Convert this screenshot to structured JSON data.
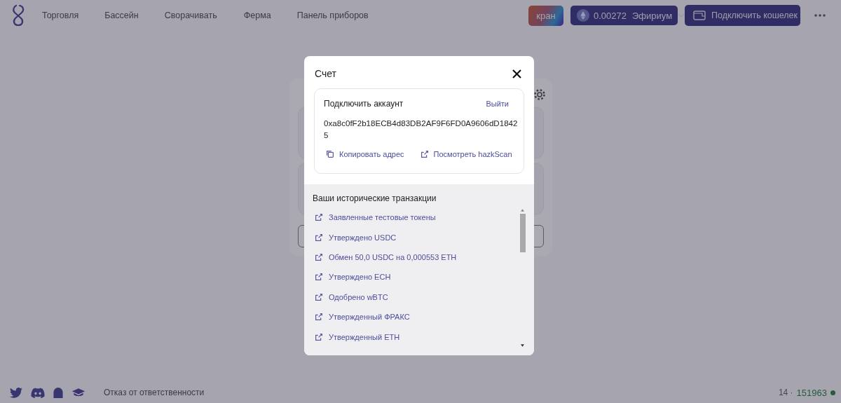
{
  "header": {
    "nav": [
      {
        "label": "Торговля"
      },
      {
        "label": "Бассейн"
      },
      {
        "label": "Сворачивать"
      },
      {
        "label": "Ферма"
      },
      {
        "label": "Панель приборов"
      }
    ],
    "faucet_button": "кран",
    "network_button": {
      "balance": "0.00272",
      "currency": "Эфириум"
    },
    "connect_button": "Подключить кошелек"
  },
  "modal": {
    "title": "Счет",
    "account": {
      "heading": "Подключить аккаунт",
      "logout": "Выйти",
      "address": "0xa8c0fF2b18ECB4d83DB2AF9F6FD0A9606dD18425",
      "actions": [
        {
          "kind": "copy",
          "label": "Копировать адрес"
        },
        {
          "kind": "external",
          "label": "Посмотреть hazkScan"
        }
      ]
    },
    "history": {
      "heading": "Ваши исторические транзакции",
      "items": [
        {
          "label": "Заявленные тестовые токены"
        },
        {
          "label": "Утверждено USDC"
        },
        {
          "label": "Обмен 50,0 USDC на 0,000553 ETH"
        },
        {
          "label": "Утверждено ECH"
        },
        {
          "label": "Одобрено wBTC"
        },
        {
          "label": "Утвержденный ФРАКС"
        },
        {
          "label": "Утвержденный ETH"
        }
      ]
    }
  },
  "footer": {
    "disclaimer": "Отказ от ответственности",
    "version": "14 ·",
    "block": "151963"
  }
}
